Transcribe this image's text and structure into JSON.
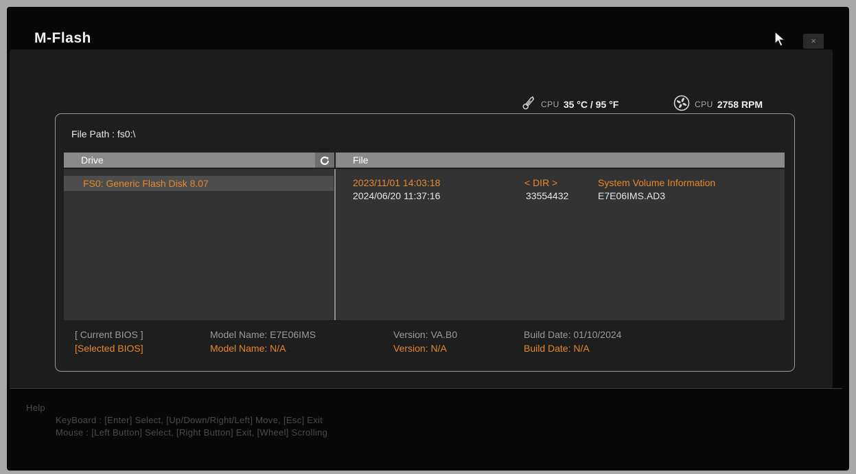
{
  "window": {
    "title": "M-Flash",
    "close_label": "×"
  },
  "sensors": {
    "cpu_temp": {
      "label": "CPU",
      "value": "35 °C / 95 °F"
    },
    "cpu_fan": {
      "label": "CPU",
      "value": "2758 RPM"
    }
  },
  "file_path": "File Path : fs0:\\",
  "drive_panel": {
    "header": "Drive",
    "refresh_icon": "refresh-icon",
    "items": [
      {
        "label": "FS0: Generic Flash Disk 8.07"
      }
    ]
  },
  "file_panel": {
    "header": "File",
    "rows": [
      {
        "date": "2023/11/01 14:03:18",
        "size": "< DIR >",
        "name": "System Volume Information",
        "highlight": true
      },
      {
        "date": "2024/06/20 11:37:16",
        "size": "33554432",
        "name": "E7E06IMS.AD3",
        "highlight": false
      }
    ]
  },
  "bios": {
    "current": {
      "tag": "[ Current BIOS ]",
      "model": "Model Name: E7E06IMS",
      "version": "Version: VA.B0",
      "build": "Build Date: 01/10/2024"
    },
    "selected": {
      "tag": "[Selected BIOS]",
      "model": "Model Name: N/A",
      "version": "Version: N/A",
      "build": "Build Date: N/A"
    }
  },
  "help": {
    "title": "Help",
    "keyboard": "KeyBoard :  [Enter]  Select,   [Up/Down/Right/Left]  Move,   [Esc]  Exit",
    "mouse": "Mouse     :  [Left Button]  Select,   [Right Button]  Exit,   [Wheel]  Scrolling"
  },
  "colors": {
    "accent": "#e8882a",
    "background": "#070707",
    "panel": "#1c1c1c"
  }
}
